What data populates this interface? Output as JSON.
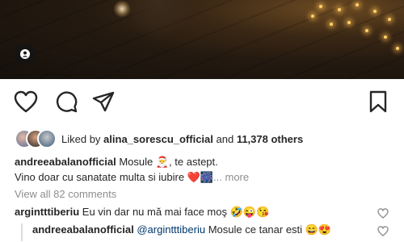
{
  "post": {
    "likes": {
      "prefix": "Liked by ",
      "user": "alina_sorescu_official",
      "joiner": " and ",
      "count": "11,378 others"
    },
    "caption": {
      "username": "andreeabalanofficial",
      "line1": "Mosule 🎅, te astept.",
      "line2": "Vino doar cu sanatate multa si iubire ❤️🎆",
      "more": "... more"
    },
    "view_all": "View all 82 comments",
    "comments": [
      {
        "username": "argintttiberiu",
        "text": "Eu vin dar nu mă mai face moş 🤣😜😘"
      },
      {
        "username": "andreeabalanofficial",
        "mention": "@argintttiberiu",
        "text": "Mosule ce tanar esti 😄😍"
      }
    ]
  },
  "icons": {
    "user_tag": "person-icon",
    "like": "heart-icon",
    "comment": "comment-bubble-icon",
    "share": "paper-plane-icon",
    "save": "bookmark-icon",
    "comment_like": "heart-icon"
  },
  "colors": {
    "text": "#262626",
    "muted": "#8e8e8e",
    "mention": "#00376b"
  }
}
